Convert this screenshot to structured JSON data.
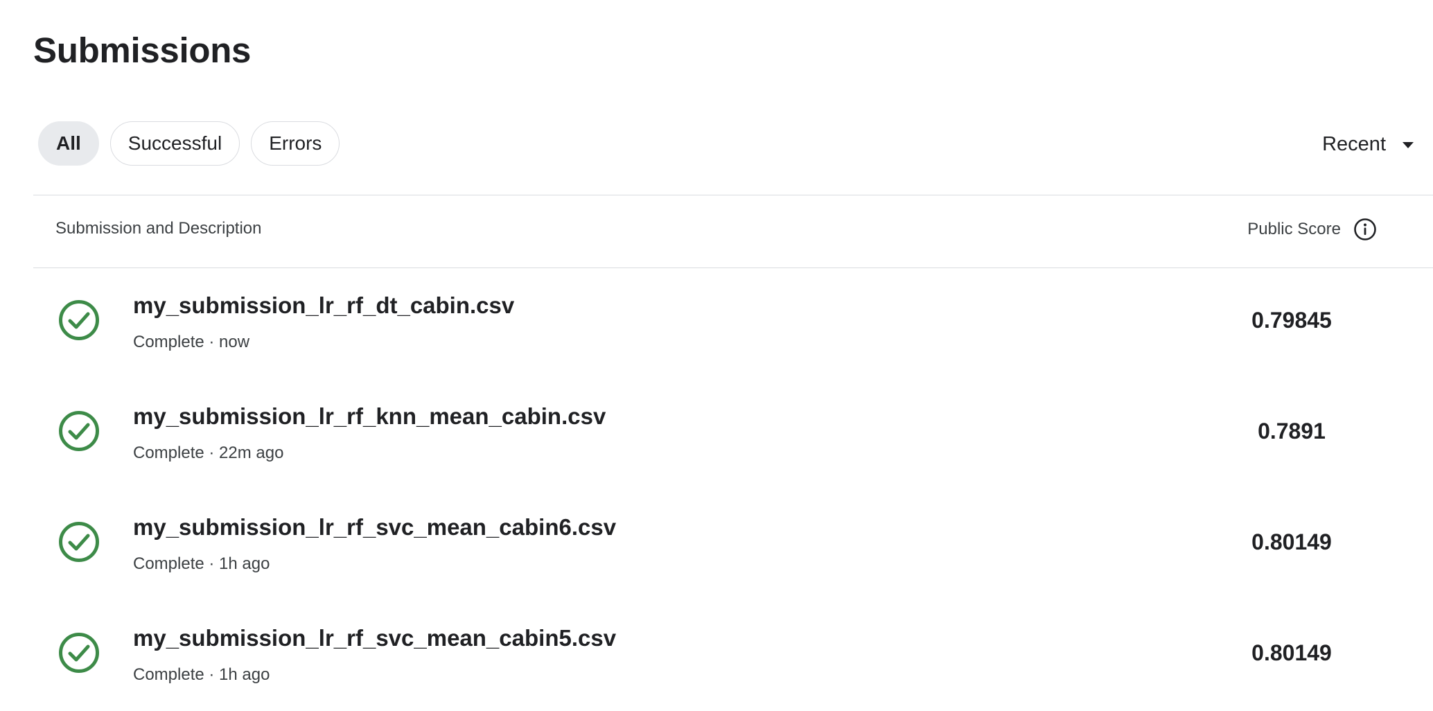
{
  "page": {
    "title": "Submissions"
  },
  "filters": {
    "items": [
      {
        "label": "All",
        "active": true
      },
      {
        "label": "Successful",
        "active": false
      },
      {
        "label": "Errors",
        "active": false
      }
    ]
  },
  "sort": {
    "label": "Recent",
    "icon": "caret-down-icon"
  },
  "table": {
    "col_description": "Submission and Description",
    "col_score": "Public Score",
    "score_info_icon": "info-icon",
    "rows": [
      {
        "file": "my_submission_lr_rf_dt_cabin.csv",
        "meta": "Complete · now",
        "score": "0.79845",
        "status_icon": "check-circle-icon"
      },
      {
        "file": "my_submission_lr_rf_knn_mean_cabin.csv",
        "meta": "Complete · 22m ago",
        "score": "0.7891",
        "status_icon": "check-circle-icon"
      },
      {
        "file": "my_submission_lr_rf_svc_mean_cabin6.csv",
        "meta": "Complete · 1h ago",
        "score": "0.80149",
        "status_icon": "check-circle-icon"
      },
      {
        "file": "my_submission_lr_rf_svc_mean_cabin5.csv",
        "meta": "Complete · 1h ago",
        "score": "0.80149",
        "status_icon": "check-circle-icon"
      }
    ]
  },
  "colors": {
    "success": "#3d8b48",
    "text": "#202124",
    "muted": "#3c4043",
    "divider": "#dadce0",
    "chip_active_bg": "#e8eaed"
  }
}
